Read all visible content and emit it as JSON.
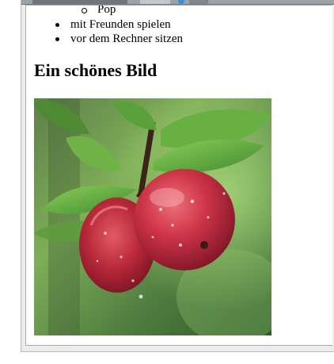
{
  "page": {
    "sublist": [
      "Pop"
    ],
    "list": [
      "mit Freunden spielen",
      "vor dem Rechner sitzen"
    ],
    "heading": "Ein schönes Bild"
  },
  "image": {
    "alt": "Zwei rote Äpfel am Zweig"
  }
}
